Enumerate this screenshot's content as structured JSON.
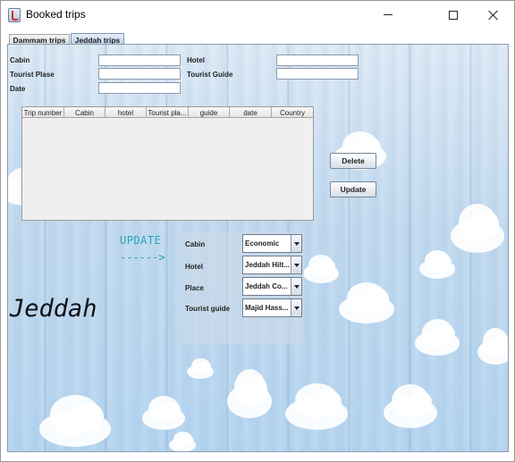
{
  "window": {
    "title": "Booked trips"
  },
  "tabs": [
    {
      "label": "Dammam trips",
      "selected": false
    },
    {
      "label": "Jeddah trips",
      "selected": true
    }
  ],
  "form": {
    "cabin_label": "Cabin",
    "hotel_label": "Hotel",
    "tourist_place_label": "Tourist Plase",
    "tourist_guide_label": "Tourist Guide",
    "date_label": "Date",
    "cabin_value": "",
    "hotel_value": "",
    "tourist_place_value": "",
    "tourist_guide_value": "",
    "date_value": ""
  },
  "table": {
    "columns": [
      "Trip number",
      "Cabin",
      "hotel",
      "Tourist pla...",
      "guide",
      "date",
      "Country"
    ],
    "rows": []
  },
  "buttons": {
    "delete": "Delete",
    "update": "Update"
  },
  "update_section": {
    "heading": "UPDATE",
    "arrow": "------>",
    "cabin_label": "Cabin",
    "hotel_label": "Hotel",
    "place_label": "Place",
    "guide_label": "Tourist guide",
    "cabin_selected": "Economic",
    "hotel_selected": "Jeddah Hilt...",
    "place_selected": "Jeddah Co...",
    "guide_selected": "Majid Hass..."
  },
  "city_name": "Jeddah",
  "colors": {
    "accent_text": "#23a7b5",
    "selected_tab": "#b9cbe2"
  }
}
